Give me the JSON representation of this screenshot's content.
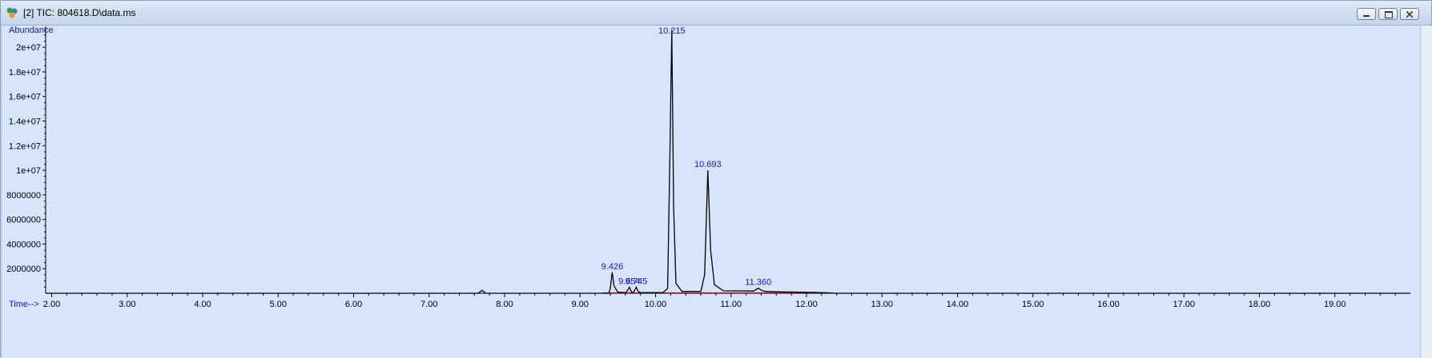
{
  "window": {
    "title": "[2] TIC: 804618.D\\data.ms",
    "icon": "chromatogram-app-icon",
    "controls": [
      "minimize-icon",
      "maximize-icon",
      "close-icon"
    ]
  },
  "colors": {
    "plot_background": "#d6e4fc",
    "trace": "#000000",
    "baseline": "#d01818",
    "labels": "#1717c9"
  },
  "chart_data": {
    "type": "line",
    "ylabel": "Abundance",
    "xlabel": "Time-->",
    "xlim": [
      1.92,
      20.0
    ],
    "ylim": [
      0,
      21700000
    ],
    "x_ticks": [
      "2.00",
      "3.00",
      "4.00",
      "5.00",
      "6.00",
      "7.00",
      "8.00",
      "9.00",
      "10.00",
      "11.00",
      "12.00",
      "13.00",
      "14.00",
      "15.00",
      "16.00",
      "17.00",
      "18.00",
      "19.00"
    ],
    "y_ticks": [
      {
        "value": 2000000,
        "label": "2000000"
      },
      {
        "value": 4000000,
        "label": "4000000"
      },
      {
        "value": 6000000,
        "label": "6000000"
      },
      {
        "value": 8000000,
        "label": "8000000"
      },
      {
        "value": 10000000,
        "label": "1e+07"
      },
      {
        "value": 12000000,
        "label": "1.2e+07"
      },
      {
        "value": 14000000,
        "label": "1.4e+07"
      },
      {
        "value": 16000000,
        "label": "1.6e+07"
      },
      {
        "value": 18000000,
        "label": "1.8e+07"
      },
      {
        "value": 20000000,
        "label": "2e+07"
      }
    ],
    "series": [
      {
        "x": [
          1.92,
          7.65,
          7.7,
          7.75,
          9.38,
          9.4,
          9.426,
          9.45,
          9.5,
          9.6,
          9.62,
          9.654,
          9.68,
          9.7,
          9.72,
          9.745,
          9.77,
          9.8,
          10.1,
          10.16,
          10.19,
          10.215,
          10.24,
          10.27,
          10.35,
          10.6,
          10.65,
          10.693,
          10.73,
          10.78,
          10.9,
          11.3,
          11.33,
          11.36,
          11.4,
          11.45,
          11.6,
          12.2,
          12.4,
          20.0
        ],
        "y": [
          0,
          0,
          250000,
          0,
          0,
          400000,
          1700000,
          600000,
          100000,
          50000,
          150000,
          500000,
          100000,
          50000,
          200000,
          500000,
          150000,
          60000,
          60000,
          400000,
          11000000,
          21400000,
          7000000,
          800000,
          150000,
          150000,
          1500000,
          10000000,
          3500000,
          700000,
          200000,
          180000,
          300000,
          420000,
          250000,
          150000,
          120000,
          60000,
          0,
          0
        ]
      }
    ],
    "peaks": [
      {
        "time": 9.426,
        "label": "9.426"
      },
      {
        "time": 9.654,
        "label": "9.654"
      },
      {
        "time": 9.745,
        "label": "9.745"
      },
      {
        "time": 10.215,
        "label": "10.215"
      },
      {
        "time": 10.693,
        "label": "10.693"
      },
      {
        "time": 11.36,
        "label": "11.360"
      }
    ],
    "grid": false,
    "legend": "none"
  }
}
